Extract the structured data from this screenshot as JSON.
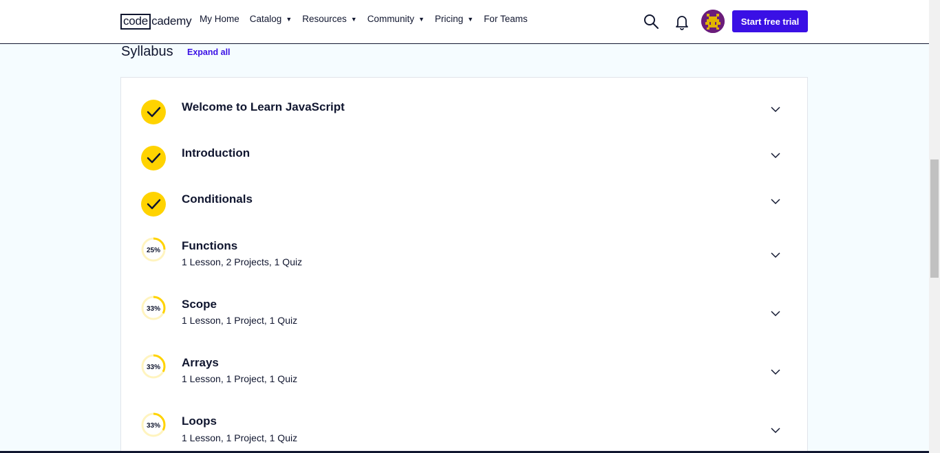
{
  "header": {
    "logo_code": "code",
    "logo_rest": "cademy",
    "nav": [
      {
        "label": "My Home",
        "dropdown": false
      },
      {
        "label": "Catalog",
        "dropdown": true
      },
      {
        "label": "Resources",
        "dropdown": true
      },
      {
        "label": "Community",
        "dropdown": true
      },
      {
        "label": "Pricing",
        "dropdown": true
      },
      {
        "label": "For Teams",
        "dropdown": false
      }
    ],
    "caret": "▼",
    "cta_label": "Start free trial",
    "icons": [
      "search-icon",
      "bell-icon"
    ],
    "accent_color": "#3a10e5"
  },
  "syllabus": {
    "title": "Syllabus",
    "expand_all": "Expand all",
    "modules": [
      {
        "title": "Welcome to Learn JavaScript",
        "subtitle": "",
        "status": "complete"
      },
      {
        "title": "Introduction",
        "subtitle": "",
        "status": "complete"
      },
      {
        "title": "Conditionals",
        "subtitle": "",
        "status": "complete"
      },
      {
        "title": "Functions",
        "subtitle": "1 Lesson, 2 Projects, 1 Quiz",
        "status": "progress",
        "progress": 25,
        "progress_label": "25%"
      },
      {
        "title": "Scope",
        "subtitle": "1 Lesson, 1 Project, 1 Quiz",
        "status": "progress",
        "progress": 33,
        "progress_label": "33%"
      },
      {
        "title": "Arrays",
        "subtitle": "1 Lesson, 1 Project, 1 Quiz",
        "status": "progress",
        "progress": 33,
        "progress_label": "33%"
      },
      {
        "title": "Loops",
        "subtitle": "1 Lesson, 1 Project, 1 Quiz",
        "status": "progress",
        "progress": 33,
        "progress_label": "33%"
      }
    ],
    "complete_color": "#ffd300"
  }
}
